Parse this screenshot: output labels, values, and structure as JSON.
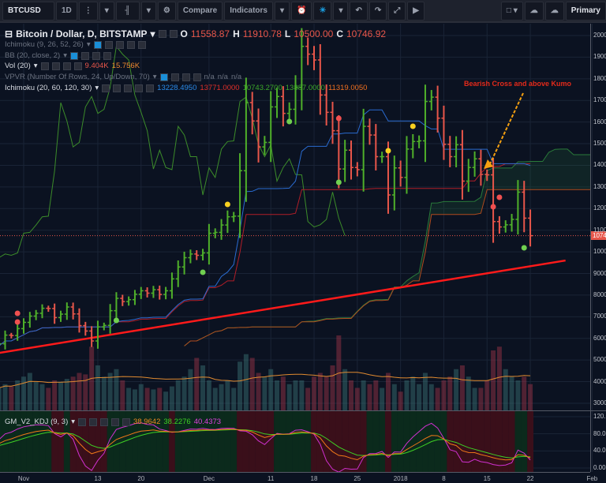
{
  "toolbar": {
    "symbol": "BTCUSD",
    "interval": "1D",
    "compare": "Compare",
    "indicators": "Indicators",
    "layout": "Primary"
  },
  "legend": {
    "title": "Bitcoin / Dollar, D, BITSTAMP",
    "o_label": "O",
    "o": "11558.87",
    "h_label": "H",
    "h": "11910.78",
    "l_label": "L",
    "l": "10500.00",
    "c_label": "C",
    "c": "10746.92",
    "ichimoku1": "Ichimoku (9, 26, 52, 26)",
    "bb": "BB (20, close, 2)",
    "vol": "Vol (20)",
    "vol_v1": "9.404K",
    "vol_v2": "15.756K",
    "vpvr": "VPVR (Number Of Rows, 24, Up/Down, 70)",
    "na1": "n/a",
    "na2": "n/a",
    "na3": "n/a",
    "ichimoku2": "Ichimoku (20, 60, 120, 30)",
    "ich_v1": "13228.4950",
    "ich_v2": "13771.0000",
    "ich_v3": "10743.2700",
    "ich_v4": "13887.0000",
    "ich_v5": "11319.0050",
    "kdj": "GM_V2_KDJ (9, 3)",
    "kdj_k": "38.9642",
    "kdj_d": "38.2276",
    "kdj_j": "40.4373"
  },
  "annotation": "Bearish Cross and above Kumo",
  "last_price_label": "10746.92",
  "colors": {
    "up": "#4fb02a",
    "down": "#e8564a",
    "conversion": "#2a6bd0",
    "base": "#b01e28",
    "lagging": "#3c8c2a",
    "spanA": "#2a7a3a",
    "spanB": "#b04a1e",
    "trend": "#ff1a1a",
    "arrow": "#f5a010",
    "k": "#f07818",
    "d": "#3ed024",
    "j": "#d030d0"
  },
  "chart_data": {
    "type": "ohlc",
    "start_date": "2017-10-28",
    "closes": [
      5750,
      6150,
      6130,
      6450,
      6740,
      7030,
      7160,
      7390,
      7380,
      6960,
      7120,
      7450,
      7130,
      6590,
      6340,
      5880,
      6530,
      6600,
      7280,
      7850,
      7700,
      7790,
      8040,
      8200,
      8090,
      8250,
      8030,
      8200,
      8750,
      9300,
      9730,
      9900,
      9840,
      9950,
      10860,
      10900,
      11240,
      11620,
      11650,
      13750,
      16900,
      16050,
      14850,
      15060,
      16700,
      17180,
      16400,
      16590,
      17600,
      19500,
      19140,
      18870,
      17250,
      16450,
      15600,
      13830,
      14700,
      13900,
      13800,
      15800,
      15400,
      14400,
      14400,
      12630,
      13880,
      13440,
      14750,
      15100,
      15130,
      16950,
      17150,
      16180,
      14970,
      14400,
      14950,
      13270,
      13900,
      14300,
      13580,
      13558,
      11400,
      11150,
      11250,
      11500,
      12760,
      11558,
      10747
    ],
    "volume_k": [
      30,
      35,
      32,
      40,
      45,
      50,
      38,
      35,
      30,
      40,
      38,
      42,
      45,
      50,
      48,
      85,
      60,
      45,
      50,
      55,
      40,
      30,
      28,
      35,
      30,
      28,
      30,
      25,
      32,
      40,
      45,
      55,
      70,
      60,
      40,
      30,
      35,
      40,
      30,
      65,
      75,
      70,
      50,
      45,
      55,
      40,
      45,
      35,
      40,
      40,
      30,
      45,
      50,
      45,
      60,
      100,
      55,
      40,
      30,
      40,
      35,
      40,
      30,
      50,
      35,
      25,
      40,
      45,
      35,
      50,
      35,
      30,
      40,
      45,
      55,
      60,
      45,
      30,
      30,
      40,
      80,
      85,
      55,
      45,
      40,
      45,
      35
    ],
    "price_axis": [
      "20000",
      "19000",
      "18000",
      "17000",
      "16000",
      "15000",
      "14000",
      "13000",
      "12000",
      "11000",
      "10000",
      "9000",
      "8000",
      "7000",
      "6000",
      "5000",
      "4000",
      "3000"
    ],
    "kdj_axis": [
      "120.0",
      "80.00",
      "40.00",
      "0.00"
    ],
    "time_axis": [
      {
        "label": "Nov",
        "i": 4
      },
      {
        "label": "13",
        "i": 16
      },
      {
        "label": "20",
        "i": 23
      },
      {
        "label": "Dec",
        "i": 34
      },
      {
        "label": "11",
        "i": 44
      },
      {
        "label": "18",
        "i": 51
      },
      {
        "label": "25",
        "i": 58
      },
      {
        "label": "2018",
        "i": 65
      },
      {
        "label": "8",
        "i": 72
      },
      {
        "label": "15",
        "i": 79
      },
      {
        "label": "22",
        "i": 86
      },
      {
        "label": "Feb",
        "i": 96
      }
    ],
    "markers": [
      {
        "i": 3,
        "p": 7158,
        "c": "red"
      },
      {
        "i": 3,
        "p": 6757,
        "c": "red"
      },
      {
        "i": 55,
        "p": 16169,
        "c": "red"
      },
      {
        "i": 81,
        "p": 12521,
        "c": "red"
      },
      {
        "i": 80,
        "p": 12083,
        "c": "red"
      },
      {
        "i": 37,
        "p": 12193,
        "c": "yellow"
      },
      {
        "i": 63,
        "p": 14673,
        "c": "yellow"
      },
      {
        "i": 67,
        "p": 15804,
        "c": "yellow"
      },
      {
        "i": 19,
        "p": 6830,
        "c": "green"
      },
      {
        "i": 33,
        "p": 9055,
        "c": "green"
      },
      {
        "i": 47,
        "p": 16023,
        "c": "green"
      },
      {
        "i": 55,
        "p": 13214,
        "c": "green"
      },
      {
        "i": 85,
        "p": 10186,
        "c": "green"
      }
    ],
    "trendline": [
      {
        "i": -3.8,
        "p": 5150
      },
      {
        "i": 91.7,
        "p": 9600
      }
    ],
    "last_price": 10746.92
  }
}
